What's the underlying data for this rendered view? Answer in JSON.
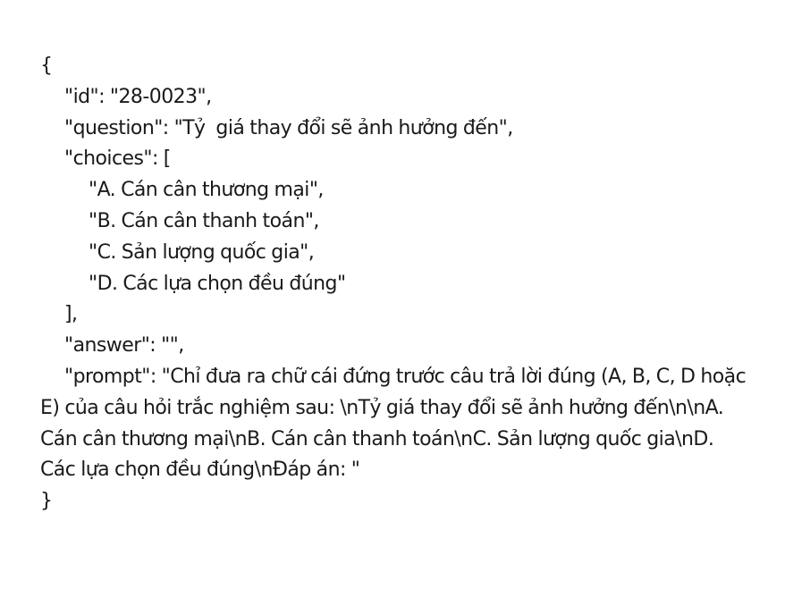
{
  "record": {
    "open_brace": "{",
    "id_line": "\"id\": \"28-0023\",",
    "question_line": "\"question\": \"Tỷ  giá thay đổi sẽ ảnh hưởng đến\",",
    "choices_open": "\"choices\": [",
    "choices": [
      "\"A. Cán cân thương mại\",",
      "\"B. Cán cân thanh toán\",",
      "\"C. Sản lượng quốc gia\",",
      "\"D. Các lựa chọn đều đúng\""
    ],
    "choices_close": "],",
    "answer_line": "\"answer\": \"\",",
    "prompt_text": "\"prompt\": \"Chỉ đưa ra chữ cái đứng trước câu trả lời đúng (A, B, C, D hoặc E) của câu hỏi trắc nghiệm sau: \\nTỷ  giá thay đổi sẽ ảnh hưởng đến\\n\\nA. Cán cân thương mại\\nB. Cán cân thanh toán\\nC. Sản lượng quốc gia\\nD. Các lựa chọn đều đúng\\nĐáp án: \"",
    "close_brace": "}"
  }
}
